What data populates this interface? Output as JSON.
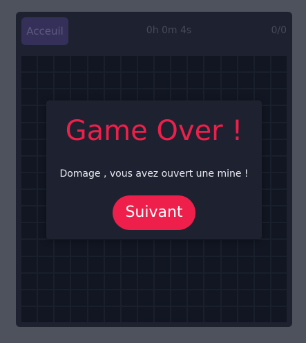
{
  "header": {
    "home_label": "Acceuil",
    "timer": "0h 0m 4s",
    "counter": "0/0"
  },
  "board": {
    "columns": 16,
    "rows": 16
  },
  "modal": {
    "title": "Game Over !",
    "message": "Domage , vous avez ouvert une mine !",
    "button_label": "Suivant"
  },
  "colors": {
    "background": "#4d525d",
    "panel": "#1e2230",
    "cell": "#111622",
    "accent": "#ef1f4b",
    "home_button": "#35305a"
  }
}
